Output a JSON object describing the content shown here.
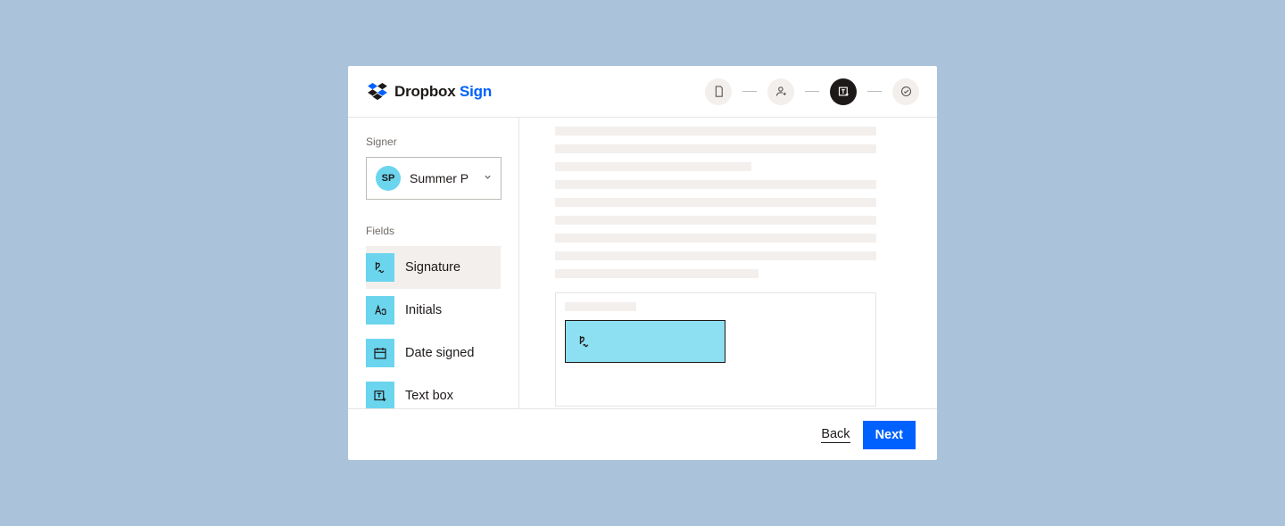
{
  "brand": {
    "name": "Dropbox",
    "product": "Sign"
  },
  "steps": [
    {
      "id": "step-document",
      "icon": "document",
      "active": false
    },
    {
      "id": "step-signers",
      "icon": "person-add",
      "active": false
    },
    {
      "id": "step-fields",
      "icon": "textbox-add",
      "active": true
    },
    {
      "id": "step-review",
      "icon": "check-circle",
      "active": false
    }
  ],
  "sidebar": {
    "signer_label": "Signer",
    "signer": {
      "initials": "SP",
      "name": "Summer P"
    },
    "fields_label": "Fields",
    "fields": [
      {
        "id": "signature",
        "label": "Signature",
        "icon": "signature",
        "selected": true
      },
      {
        "id": "initials",
        "label": "Initials",
        "icon": "initials",
        "selected": false
      },
      {
        "id": "date-signed",
        "label": "Date signed",
        "icon": "calendar",
        "selected": false
      },
      {
        "id": "textbox",
        "label": "Text box",
        "icon": "textbox-add",
        "selected": false
      }
    ]
  },
  "footer": {
    "back": "Back",
    "next": "Next"
  }
}
